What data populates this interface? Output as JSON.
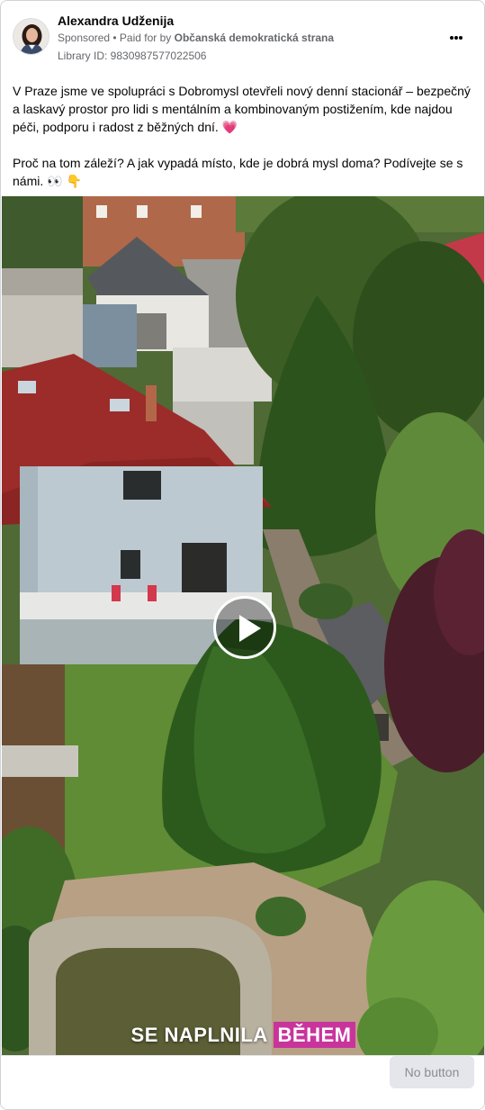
{
  "post": {
    "author": "Alexandra Udženija",
    "sponsored_label": "Sponsored",
    "paid_prefix": "• Paid for by",
    "paid_by": "Občanská demokratická strana",
    "library_id": "Library ID: 9830987577022506",
    "more_icon": "more-horizontal-icon"
  },
  "body": {
    "paragraph_1": "V Praze jsme ve spolupráci s Dobromysl otevřeli nový denní stacionář – bezpečný a laskavý prostor pro lidi s mentálním a kombinovaným postižením, kde najdou péči, podporu i radost z běžných dní. 💗",
    "paragraph_2": "Proč na tom záleží? A jak vypadá místo, kde je dobrá mysl doma? Podívejte se s námi. 👀 👇"
  },
  "media": {
    "caption_plain": "SE NAPLNILA",
    "caption_highlight": "BĚHEM",
    "caption_highlight_color": "#c8349c",
    "play_icon": "play-icon"
  },
  "footer": {
    "cta_label": "No button"
  }
}
